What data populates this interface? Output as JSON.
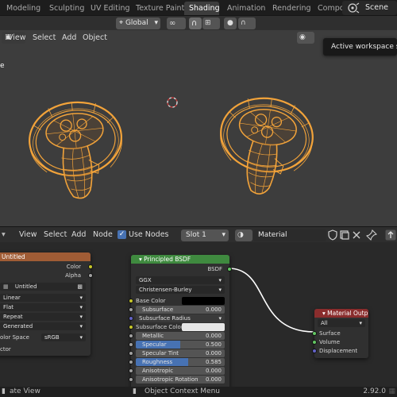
{
  "workspace_tabs": [
    {
      "label": "Modeling",
      "active": false
    },
    {
      "label": "Sculpting",
      "active": false
    },
    {
      "label": "UV Editing",
      "active": false
    },
    {
      "label": "Texture Paint",
      "active": false
    },
    {
      "label": "Shading",
      "active": true
    },
    {
      "label": "Animation",
      "active": false
    },
    {
      "label": "Rendering",
      "active": false
    },
    {
      "label": "Compos",
      "active": false
    }
  ],
  "scene": {
    "label": "Scene",
    "icon": "scene-icon"
  },
  "tooltip": {
    "text": "Active workspace sho"
  },
  "viewport": {
    "toolbar": {
      "transform_orientation": "Global",
      "icons": [
        "cursor-icon",
        "global-axes-icon",
        "link-icon",
        "magnet-icon",
        "snap-grid-icon",
        "proportional-edit-icon",
        "falloff-icon"
      ]
    },
    "menu": [
      "View",
      "Select",
      "Add",
      "Object"
    ],
    "edge_label": "e",
    "wire_color": "#f2a33a",
    "background": "#3d3d3d"
  },
  "node_editor": {
    "menu": [
      "View",
      "Select",
      "Add",
      "Node"
    ],
    "use_nodes_label": "Use Nodes",
    "use_nodes_checked": true,
    "slot": "Slot 1",
    "material_name": "Material",
    "image_node": {
      "title": "Untitled",
      "outputs": [
        "Color",
        "Alpha"
      ],
      "image_name": "Untitled",
      "interpolation": "Linear",
      "projection": "Flat",
      "extension": "Repeat",
      "source": "Generated",
      "color_space_label": "olor Space",
      "color_space_value": "sRGB",
      "vector_label": "ctor",
      "header_color": "#a05c35"
    },
    "bsdf_node": {
      "title": "Principled BSDF",
      "output": "BSDF",
      "distribution": "GGX",
      "subsurface_method": "Christensen-Burley",
      "header_color": "#3f8a3f",
      "inputs": [
        {
          "label": "Base Color",
          "type": "color",
          "color": "#000000",
          "socket": "yellow"
        },
        {
          "label": "Subsurface",
          "value": "0.000",
          "fraction": 0.0,
          "socket": "gray"
        },
        {
          "label": "Subsurface Radius",
          "type": "dropdown",
          "socket": "purple"
        },
        {
          "label": "Subsurface Color",
          "type": "color",
          "color": "#e6e6e6",
          "socket": "yellow"
        },
        {
          "label": "Metallic",
          "value": "0.000",
          "fraction": 0.0,
          "socket": "gray"
        },
        {
          "label": "Specular",
          "value": "0.500",
          "fraction": 0.5,
          "socket": "gray"
        },
        {
          "label": "Specular Tint",
          "value": "0.000",
          "fraction": 0.0,
          "socket": "gray"
        },
        {
          "label": "Roughness",
          "value": "0.585",
          "fraction": 0.585,
          "socket": "gray"
        },
        {
          "label": "Anisotropic",
          "value": "0.000",
          "fraction": 0.0,
          "socket": "gray"
        },
        {
          "label": "Anisotropic Rotation",
          "value": "0.000",
          "fraction": 0.0,
          "socket": "gray"
        }
      ]
    },
    "output_node": {
      "title": "Material Output",
      "target": "All",
      "inputs": [
        "Surface",
        "Volume",
        "Displacement"
      ],
      "header_color": "#8a2d2d"
    }
  },
  "status_bar": {
    "left": "ate View",
    "center": "Object Context Menu",
    "version": "2.92.0"
  }
}
